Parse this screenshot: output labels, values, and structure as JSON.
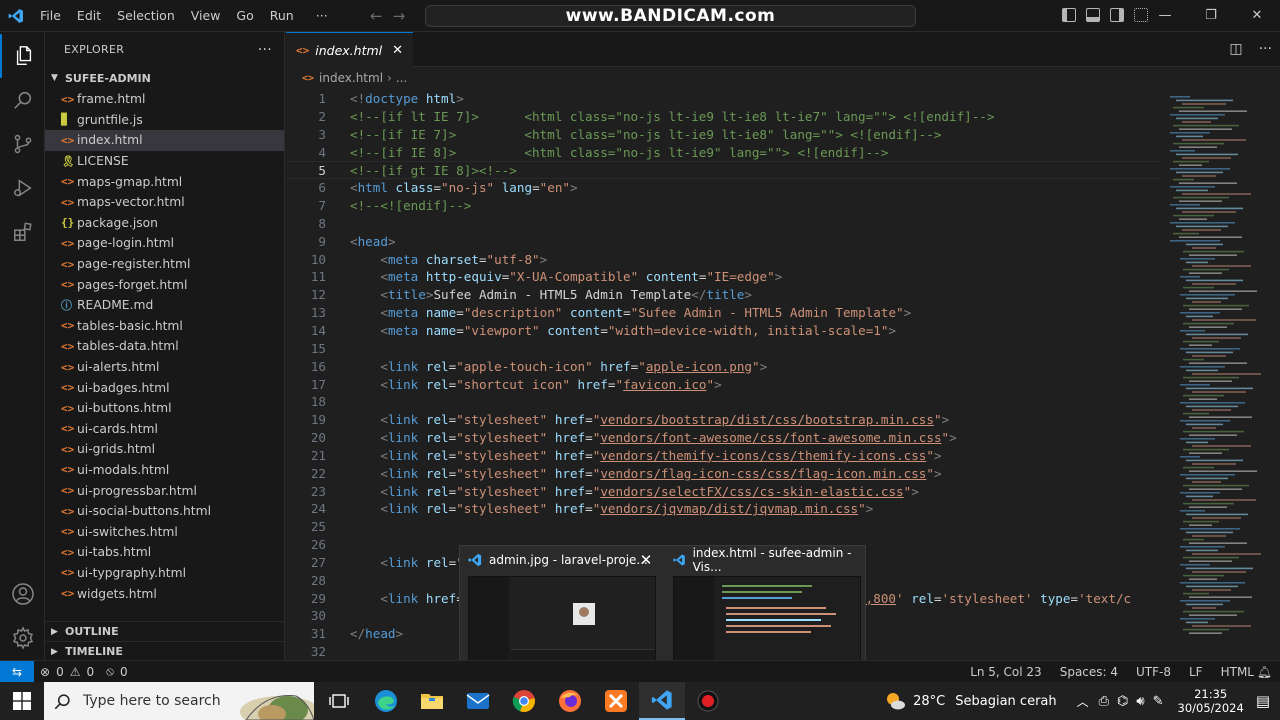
{
  "titlebar": {
    "menu": [
      "File",
      "Edit",
      "Selection",
      "View",
      "Go",
      "Run",
      "···"
    ],
    "watermark": "www.BANDICAM.com",
    "window_controls": [
      "—",
      "❐",
      "✕"
    ]
  },
  "activity_bar": {
    "items": [
      "explorer",
      "search",
      "source-control",
      "run-debug",
      "extensions"
    ],
    "bottom": [
      "accounts",
      "settings"
    ]
  },
  "sidebar": {
    "title": "EXPLORER",
    "more": "···",
    "folder": "SUFEE-ADMIN",
    "files": [
      {
        "name": "frame.html",
        "icon": "<>",
        "color": "#e37933"
      },
      {
        "name": "gruntfile.js",
        "icon": "▉",
        "color": "#cbcb41"
      },
      {
        "name": "index.html",
        "icon": "<>",
        "color": "#e37933",
        "selected": true
      },
      {
        "name": "LICENSE",
        "icon": "🎗",
        "color": "#cbcb41"
      },
      {
        "name": "maps-gmap.html",
        "icon": "<>",
        "color": "#e37933"
      },
      {
        "name": "maps-vector.html",
        "icon": "<>",
        "color": "#e37933"
      },
      {
        "name": "package.json",
        "icon": "{}",
        "color": "#cbcb41"
      },
      {
        "name": "page-login.html",
        "icon": "<>",
        "color": "#e37933"
      },
      {
        "name": "page-register.html",
        "icon": "<>",
        "color": "#e37933"
      },
      {
        "name": "pages-forget.html",
        "icon": "<>",
        "color": "#e37933"
      },
      {
        "name": "README.md",
        "icon": "ⓘ",
        "color": "#519aba"
      },
      {
        "name": "tables-basic.html",
        "icon": "<>",
        "color": "#e37933"
      },
      {
        "name": "tables-data.html",
        "icon": "<>",
        "color": "#e37933"
      },
      {
        "name": "ui-alerts.html",
        "icon": "<>",
        "color": "#e37933"
      },
      {
        "name": "ui-badges.html",
        "icon": "<>",
        "color": "#e37933"
      },
      {
        "name": "ui-buttons.html",
        "icon": "<>",
        "color": "#e37933"
      },
      {
        "name": "ui-cards.html",
        "icon": "<>",
        "color": "#e37933"
      },
      {
        "name": "ui-grids.html",
        "icon": "<>",
        "color": "#e37933"
      },
      {
        "name": "ui-modals.html",
        "icon": "<>",
        "color": "#e37933"
      },
      {
        "name": "ui-progressbar.html",
        "icon": "<>",
        "color": "#e37933"
      },
      {
        "name": "ui-social-buttons.html",
        "icon": "<>",
        "color": "#e37933"
      },
      {
        "name": "ui-switches.html",
        "icon": "<>",
        "color": "#e37933"
      },
      {
        "name": "ui-tabs.html",
        "icon": "<>",
        "color": "#e37933"
      },
      {
        "name": "ui-typgraphy.html",
        "icon": "<>",
        "color": "#e37933"
      },
      {
        "name": "widgets.html",
        "icon": "<>",
        "color": "#e37933"
      }
    ],
    "outline": "OUTLINE",
    "timeline": "TIMELINE"
  },
  "editor": {
    "tab": {
      "label": "index.html",
      "icon": "<>",
      "close": "✕"
    },
    "breadcrumb": {
      "file": "index.html",
      "rest": "..."
    },
    "current_line": 5,
    "lines": [
      {
        "n": "1",
        "t": [
          [
            "br",
            "<!"
          ],
          [
            "tag",
            "doctype"
          ],
          [
            "text",
            " "
          ],
          [
            "attr",
            "html"
          ],
          [
            "br",
            ">"
          ]
        ]
      },
      {
        "n": "2",
        "t": [
          [
            "com",
            "<!--[if lt IE 7]>      <html class=\"no-js lt-ie9 lt-ie8 lt-ie7\" lang=\"\"> <![endif]-->"
          ]
        ]
      },
      {
        "n": "3",
        "t": [
          [
            "com",
            "<!--[if IE 7]>         <html class=\"no-js lt-ie9 lt-ie8\" lang=\"\"> <![endif]-->"
          ]
        ]
      },
      {
        "n": "4",
        "t": [
          [
            "com",
            "<!--[if IE 8]>         <html class=\"no-js lt-ie9\" lang=\"\"> <![endif]-->"
          ]
        ]
      },
      {
        "n": "5",
        "t": [
          [
            "com",
            "<!--[if gt IE 8]><!-->"
          ]
        ]
      },
      {
        "n": "6",
        "t": [
          [
            "br",
            "<"
          ],
          [
            "tag",
            "html"
          ],
          [
            "text",
            " "
          ],
          [
            "attr",
            "class"
          ],
          [
            "text",
            "="
          ],
          [
            "str",
            "\"no-js\""
          ],
          [
            "text",
            " "
          ],
          [
            "attr",
            "lang"
          ],
          [
            "text",
            "="
          ],
          [
            "str",
            "\"en\""
          ],
          [
            "br",
            ">"
          ]
        ]
      },
      {
        "n": "7",
        "t": [
          [
            "com",
            "<!--<![endif]-->"
          ]
        ]
      },
      {
        "n": "8",
        "t": []
      },
      {
        "n": "9",
        "t": [
          [
            "br",
            "<"
          ],
          [
            "tag",
            "head"
          ],
          [
            "br",
            ">"
          ]
        ]
      },
      {
        "n": "10",
        "t": [
          [
            "text",
            "    "
          ],
          [
            "br",
            "<"
          ],
          [
            "tag",
            "meta"
          ],
          [
            "text",
            " "
          ],
          [
            "attr",
            "charset"
          ],
          [
            "text",
            "="
          ],
          [
            "str",
            "\"utf-8\""
          ],
          [
            "br",
            ">"
          ]
        ]
      },
      {
        "n": "11",
        "t": [
          [
            "text",
            "    "
          ],
          [
            "br",
            "<"
          ],
          [
            "tag",
            "meta"
          ],
          [
            "text",
            " "
          ],
          [
            "attr",
            "http-equiv"
          ],
          [
            "text",
            "="
          ],
          [
            "str",
            "\"X-UA-Compatible\""
          ],
          [
            "text",
            " "
          ],
          [
            "attr",
            "content"
          ],
          [
            "text",
            "="
          ],
          [
            "str",
            "\"IE=edge\""
          ],
          [
            "br",
            ">"
          ]
        ]
      },
      {
        "n": "12",
        "t": [
          [
            "text",
            "    "
          ],
          [
            "br",
            "<"
          ],
          [
            "tag",
            "title"
          ],
          [
            "br",
            ">"
          ],
          [
            "text",
            "Sufee Admin - HTML5 Admin Template"
          ],
          [
            "br",
            "</"
          ],
          [
            "tag",
            "title"
          ],
          [
            "br",
            ">"
          ]
        ]
      },
      {
        "n": "13",
        "t": [
          [
            "text",
            "    "
          ],
          [
            "br",
            "<"
          ],
          [
            "tag",
            "meta"
          ],
          [
            "text",
            " "
          ],
          [
            "attr",
            "name"
          ],
          [
            "text",
            "="
          ],
          [
            "str",
            "\"description\""
          ],
          [
            "text",
            " "
          ],
          [
            "attr",
            "content"
          ],
          [
            "text",
            "="
          ],
          [
            "str",
            "\"Sufee Admin - HTML5 Admin Template\""
          ],
          [
            "br",
            ">"
          ]
        ]
      },
      {
        "n": "14",
        "t": [
          [
            "text",
            "    "
          ],
          [
            "br",
            "<"
          ],
          [
            "tag",
            "meta"
          ],
          [
            "text",
            " "
          ],
          [
            "attr",
            "name"
          ],
          [
            "text",
            "="
          ],
          [
            "str",
            "\"viewport\""
          ],
          [
            "text",
            " "
          ],
          [
            "attr",
            "content"
          ],
          [
            "text",
            "="
          ],
          [
            "str",
            "\"width=device-width, initial-scale=1\""
          ],
          [
            "br",
            ">"
          ]
        ]
      },
      {
        "n": "15",
        "t": []
      },
      {
        "n": "16",
        "t": [
          [
            "text",
            "    "
          ],
          [
            "br",
            "<"
          ],
          [
            "tag",
            "link"
          ],
          [
            "text",
            " "
          ],
          [
            "attr",
            "rel"
          ],
          [
            "text",
            "="
          ],
          [
            "str",
            "\"apple-touch-icon\""
          ],
          [
            "text",
            " "
          ],
          [
            "attr",
            "href"
          ],
          [
            "text",
            "="
          ],
          [
            "str",
            "\""
          ],
          [
            "link",
            "apple-icon.png"
          ],
          [
            "str",
            "\""
          ],
          [
            "br",
            ">"
          ]
        ]
      },
      {
        "n": "17",
        "t": [
          [
            "text",
            "    "
          ],
          [
            "br",
            "<"
          ],
          [
            "tag",
            "link"
          ],
          [
            "text",
            " "
          ],
          [
            "attr",
            "rel"
          ],
          [
            "text",
            "="
          ],
          [
            "str",
            "\"shortcut icon\""
          ],
          [
            "text",
            " "
          ],
          [
            "attr",
            "href"
          ],
          [
            "text",
            "="
          ],
          [
            "str",
            "\""
          ],
          [
            "link",
            "favicon.ico"
          ],
          [
            "str",
            "\""
          ],
          [
            "br",
            ">"
          ]
        ]
      },
      {
        "n": "18",
        "t": []
      },
      {
        "n": "19",
        "t": [
          [
            "text",
            "    "
          ],
          [
            "br",
            "<"
          ],
          [
            "tag",
            "link"
          ],
          [
            "text",
            " "
          ],
          [
            "attr",
            "rel"
          ],
          [
            "text",
            "="
          ],
          [
            "str",
            "\"stylesheet\""
          ],
          [
            "text",
            " "
          ],
          [
            "attr",
            "href"
          ],
          [
            "text",
            "="
          ],
          [
            "str",
            "\""
          ],
          [
            "link",
            "vendors/bootstrap/dist/css/bootstrap.min.css"
          ],
          [
            "str",
            "\""
          ],
          [
            "br",
            ">"
          ]
        ]
      },
      {
        "n": "20",
        "t": [
          [
            "text",
            "    "
          ],
          [
            "br",
            "<"
          ],
          [
            "tag",
            "link"
          ],
          [
            "text",
            " "
          ],
          [
            "attr",
            "rel"
          ],
          [
            "text",
            "="
          ],
          [
            "str",
            "\"stylesheet\""
          ],
          [
            "text",
            " "
          ],
          [
            "attr",
            "href"
          ],
          [
            "text",
            "="
          ],
          [
            "str",
            "\""
          ],
          [
            "link",
            "vendors/font-awesome/css/font-awesome.min.css"
          ],
          [
            "str",
            "\""
          ],
          [
            "br",
            ">"
          ]
        ]
      },
      {
        "n": "21",
        "t": [
          [
            "text",
            "    "
          ],
          [
            "br",
            "<"
          ],
          [
            "tag",
            "link"
          ],
          [
            "text",
            " "
          ],
          [
            "attr",
            "rel"
          ],
          [
            "text",
            "="
          ],
          [
            "str",
            "\"stylesheet\""
          ],
          [
            "text",
            " "
          ],
          [
            "attr",
            "href"
          ],
          [
            "text",
            "="
          ],
          [
            "str",
            "\""
          ],
          [
            "link",
            "vendors/themify-icons/css/themify-icons.css"
          ],
          [
            "str",
            "\""
          ],
          [
            "br",
            ">"
          ]
        ]
      },
      {
        "n": "22",
        "t": [
          [
            "text",
            "    "
          ],
          [
            "br",
            "<"
          ],
          [
            "tag",
            "link"
          ],
          [
            "text",
            " "
          ],
          [
            "attr",
            "rel"
          ],
          [
            "text",
            "="
          ],
          [
            "str",
            "\"stylesheet\""
          ],
          [
            "text",
            " "
          ],
          [
            "attr",
            "href"
          ],
          [
            "text",
            "="
          ],
          [
            "str",
            "\""
          ],
          [
            "link",
            "vendors/flag-icon-css/css/flag-icon.min.css"
          ],
          [
            "str",
            "\""
          ],
          [
            "br",
            ">"
          ]
        ]
      },
      {
        "n": "23",
        "t": [
          [
            "text",
            "    "
          ],
          [
            "br",
            "<"
          ],
          [
            "tag",
            "link"
          ],
          [
            "text",
            " "
          ],
          [
            "attr",
            "rel"
          ],
          [
            "text",
            "="
          ],
          [
            "str",
            "\"stylesheet\""
          ],
          [
            "text",
            " "
          ],
          [
            "attr",
            "href"
          ],
          [
            "text",
            "="
          ],
          [
            "str",
            "\""
          ],
          [
            "link",
            "vendors/selectFX/css/cs-skin-elastic.css"
          ],
          [
            "str",
            "\""
          ],
          [
            "br",
            ">"
          ]
        ]
      },
      {
        "n": "24",
        "t": [
          [
            "text",
            "    "
          ],
          [
            "br",
            "<"
          ],
          [
            "tag",
            "link"
          ],
          [
            "text",
            " "
          ],
          [
            "attr",
            "rel"
          ],
          [
            "text",
            "="
          ],
          [
            "str",
            "\"stylesheet\""
          ],
          [
            "text",
            " "
          ],
          [
            "attr",
            "href"
          ],
          [
            "text",
            "="
          ],
          [
            "str",
            "\""
          ],
          [
            "link",
            "vendors/jqvmap/dist/jqvmap.min.css"
          ],
          [
            "str",
            "\""
          ],
          [
            "br",
            ">"
          ]
        ]
      },
      {
        "n": "25",
        "t": []
      },
      {
        "n": "26",
        "t": []
      },
      {
        "n": "27",
        "t": [
          [
            "text",
            "    "
          ],
          [
            "br",
            "<"
          ],
          [
            "tag",
            "link"
          ],
          [
            "text",
            " "
          ],
          [
            "attr",
            "rel"
          ],
          [
            "text",
            "="
          ],
          [
            "str",
            "\""
          ]
        ]
      },
      {
        "n": "28",
        "t": []
      },
      {
        "n": "29",
        "t": [
          [
            "text",
            "    "
          ],
          [
            "br",
            "<"
          ],
          [
            "tag",
            "link"
          ],
          [
            "text",
            " "
          ],
          [
            "attr",
            "href"
          ],
          [
            "text",
            "="
          ],
          [
            "str",
            "                                               "
          ],
          [
            "link",
            "00,700,800"
          ],
          [
            "str",
            "'"
          ],
          [
            "text",
            " "
          ],
          [
            "attr",
            "rel"
          ],
          [
            "text",
            "="
          ],
          [
            "str",
            "'stylesheet'"
          ],
          [
            "text",
            " "
          ],
          [
            "attr",
            "type"
          ],
          [
            "text",
            "="
          ],
          [
            "str",
            "'text/c"
          ]
        ]
      },
      {
        "n": "30",
        "t": []
      },
      {
        "n": "31",
        "t": [
          [
            "br",
            "</"
          ],
          [
            "tag",
            "head"
          ],
          [
            "br",
            ">"
          ]
        ]
      },
      {
        "n": "32",
        "t": [
          [
            "text",
            ""
          ]
        ]
      }
    ]
  },
  "preview": {
    "items": [
      {
        "title": "admin.jpg - laravel-proje...",
        "close": "✕"
      },
      {
        "title": "index.html - sufee-admin - Vis..."
      }
    ]
  },
  "statusbar": {
    "remote": "⇆",
    "errors": "0",
    "warnings": "0",
    "ports": "0",
    "position": "Ln 5, Col 23",
    "spaces": "Spaces: 4",
    "encoding": "UTF-8",
    "eol": "LF",
    "language": "HTML"
  },
  "taskbar": {
    "search_placeholder": "Type here to search",
    "weather_temp": "28°C",
    "weather_desc": "Sebagian cerah",
    "time": "21:35",
    "date": "30/05/2024"
  }
}
